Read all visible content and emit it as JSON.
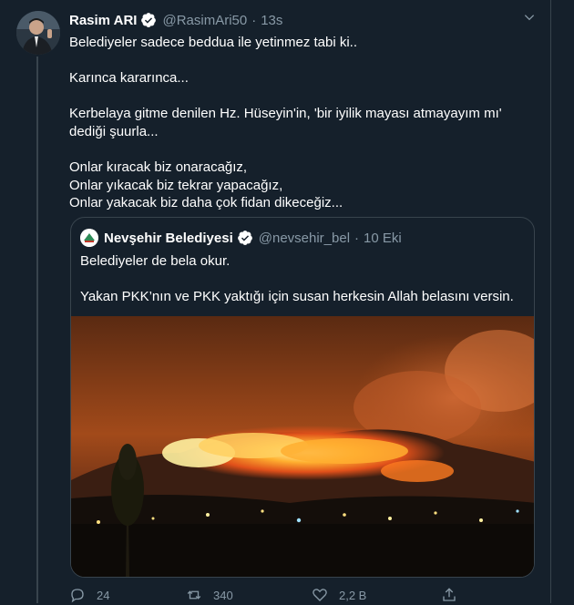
{
  "tweet": {
    "author_name": "Rasim ARI",
    "handle": "@RasimAri50",
    "separator": "·",
    "time": "13s",
    "text": "Belediyeler sadece beddua ile yetinmez tabi ki..\n\nKarınca kararınca...\n\nKerbelaya gitme denilen Hz. Hüseyin'in, 'bir iyilik mayası atmayayım mı' dediği şuurla...\n\nOnlar kıracak biz onaracağız,\nOnlar yıkacak biz tekrar yapacağız,\nOnlar yakacak biz daha çok fidan dikeceğiz..."
  },
  "quoted": {
    "author_name": "Nevşehir Belediyesi",
    "handle": "@nevsehir_bel",
    "separator": "·",
    "time": "10 Eki",
    "text": "Belediyeler de bela okur.\n\nYakan PKK’nın ve PKK yaktığı için susan herkesin Allah belasını versin."
  },
  "actions": {
    "reply_count": "24",
    "retweet_count": "340",
    "like_count": "2,2 B"
  },
  "icons": {
    "verified": "verified-badge-icon",
    "more": "chevron-down-icon",
    "reply": "reply-icon",
    "retweet": "retweet-icon",
    "like": "heart-icon",
    "share": "share-icon"
  },
  "colors": {
    "background": "#15202b",
    "secondary_text": "#8899a6",
    "border": "#38444d",
    "verified": "#ffffff"
  }
}
